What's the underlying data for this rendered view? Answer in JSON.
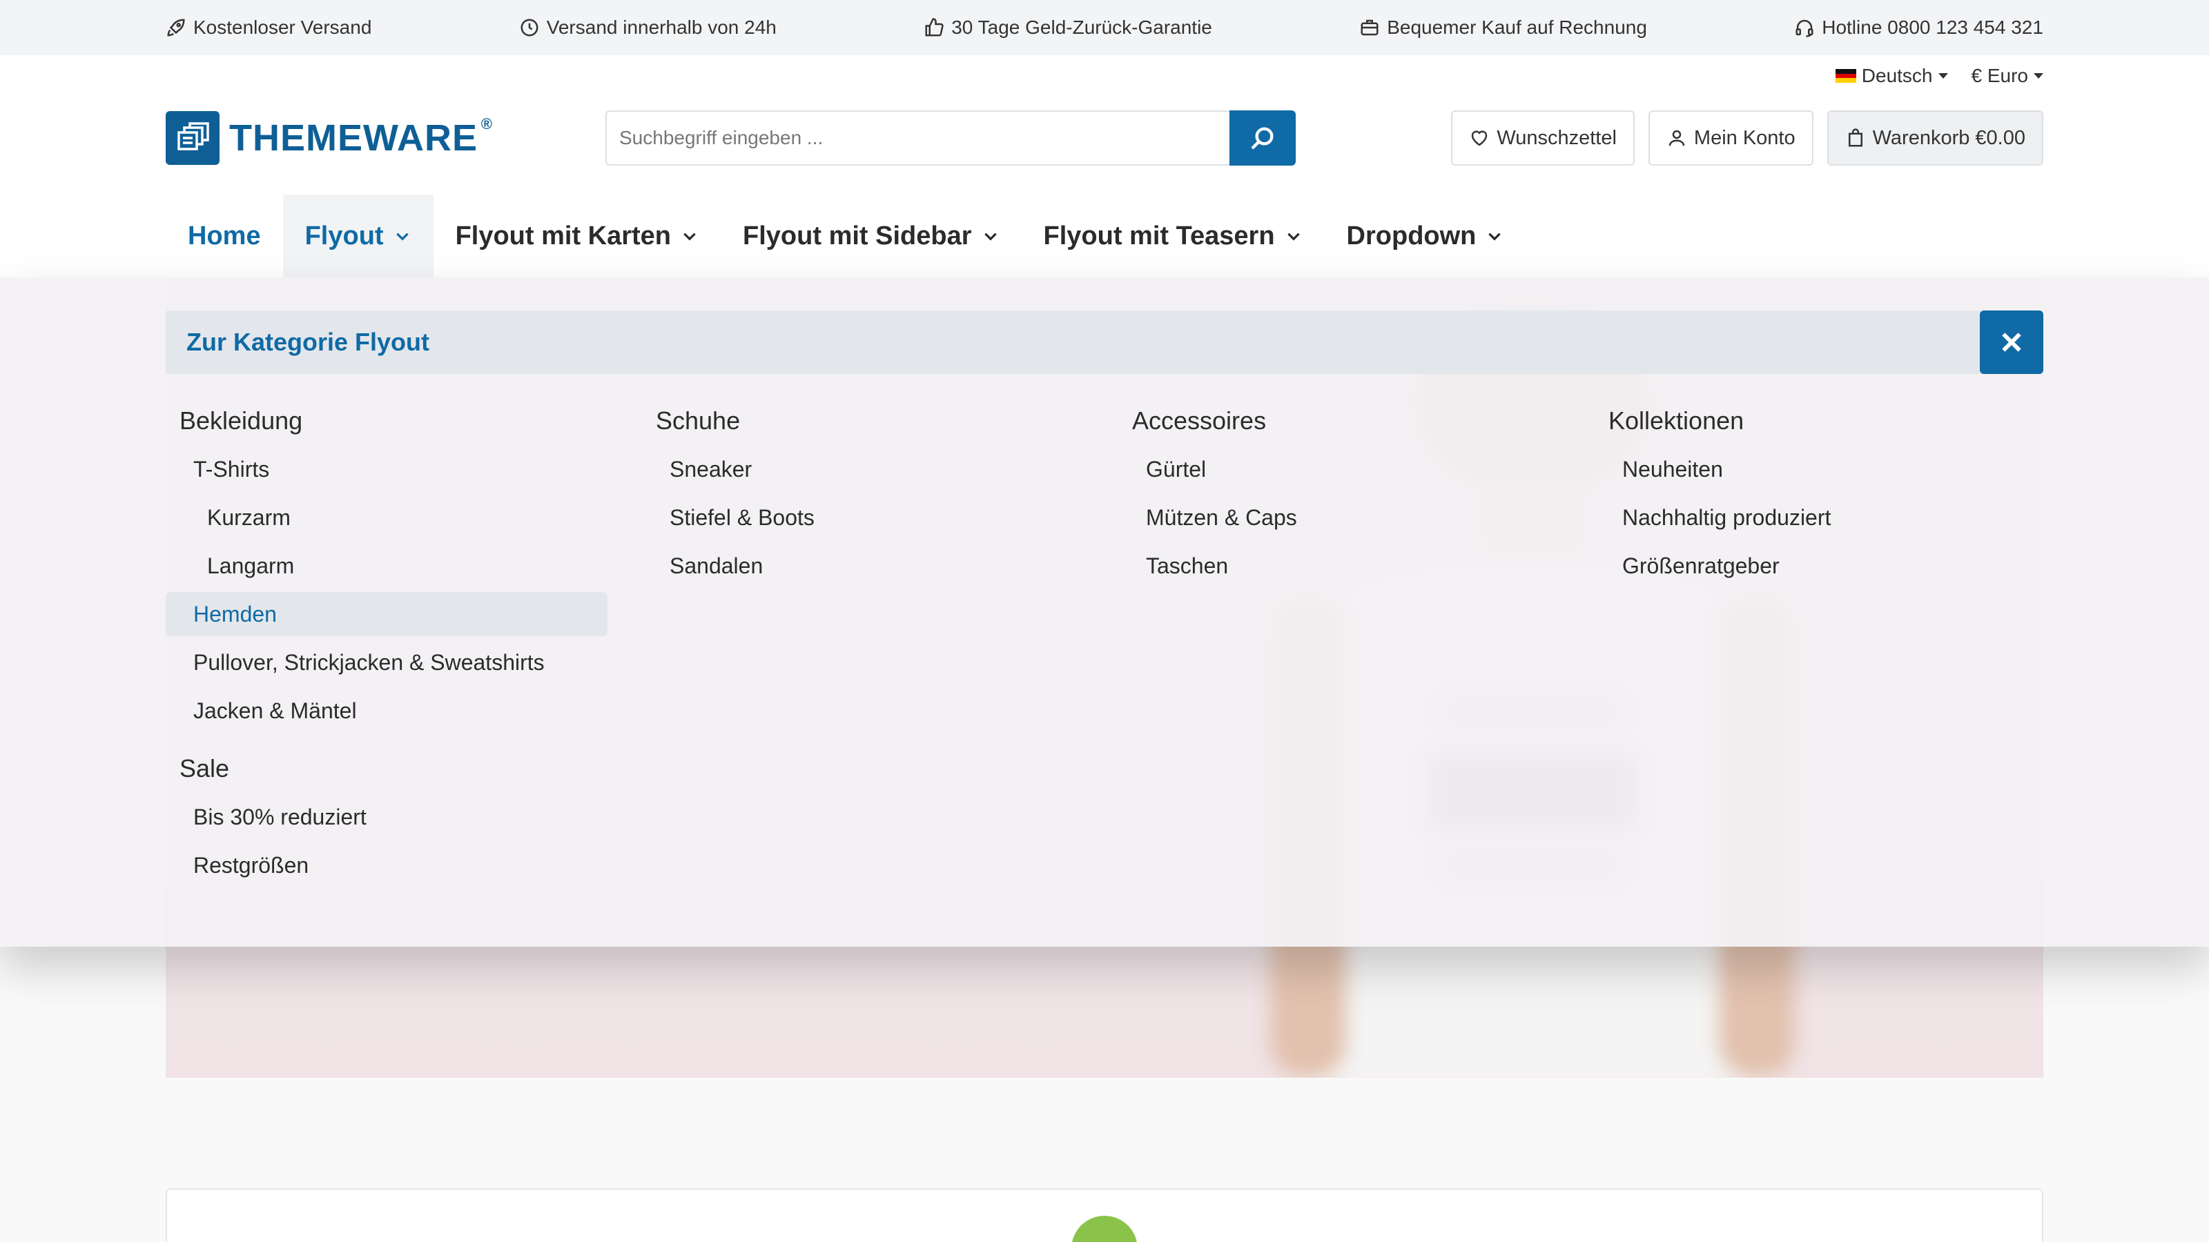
{
  "topbar": {
    "usps": [
      {
        "icon": "rocket-icon",
        "label": "Kostenloser Versand"
      },
      {
        "icon": "clock-icon",
        "label": "Versand innerhalb von 24h"
      },
      {
        "icon": "thumbs-up-icon",
        "label": "30 Tage Geld-Zurück-Garantie"
      },
      {
        "icon": "briefcase-icon",
        "label": "Bequemer Kauf auf Rechnung"
      },
      {
        "icon": "headset-icon",
        "label": "Hotline 0800 123 454 321"
      }
    ]
  },
  "header": {
    "language": "Deutsch",
    "currency": "€ Euro",
    "logo_text": "THEMEWARE",
    "logo_mark": "®",
    "search": {
      "placeholder": "Suchbegriff eingeben ..."
    },
    "wishlist_label": "Wunschzettel",
    "account_label": "Mein Konto",
    "cart_label": "Warenkorb €0.00"
  },
  "nav": {
    "items": [
      {
        "label": "Home"
      },
      {
        "label": "Flyout"
      },
      {
        "label": "Flyout mit Karten"
      },
      {
        "label": "Flyout mit Sidebar"
      },
      {
        "label": "Flyout mit Teasern"
      },
      {
        "label": "Dropdown"
      }
    ],
    "active_index": 1
  },
  "flyout": {
    "category_link": "Zur Kategorie Flyout",
    "columns": [
      {
        "title": "Bekleidung",
        "items": [
          "T-Shirts",
          "Kurzarm",
          "Langarm",
          "Hemden",
          "Pullover, Strickjacken & Sweatshirts",
          "Jacken & Mäntel"
        ],
        "title2": "Sale",
        "items2": [
          "Bis 30% reduziert",
          "Restgrößen"
        ]
      },
      {
        "title": "Schuhe",
        "items": [
          "Sneaker",
          "Stiefel & Boots",
          "Sandalen"
        ]
      },
      {
        "title": "Accessoires",
        "items": [
          "Gürtel",
          "Mützen & Caps",
          "Taschen"
        ]
      },
      {
        "title": "Kollektionen",
        "items": [
          "Neuheiten",
          "Nachhaltig produziert",
          "Größenratgeber"
        ]
      }
    ]
  },
  "colors": {
    "primary": "#0f6aa5",
    "logo": "#0f5f96",
    "topbar_bg": "#f3f4f6",
    "highlight_bg": "#e3e7ec",
    "accent_green": "#8bc34a"
  }
}
